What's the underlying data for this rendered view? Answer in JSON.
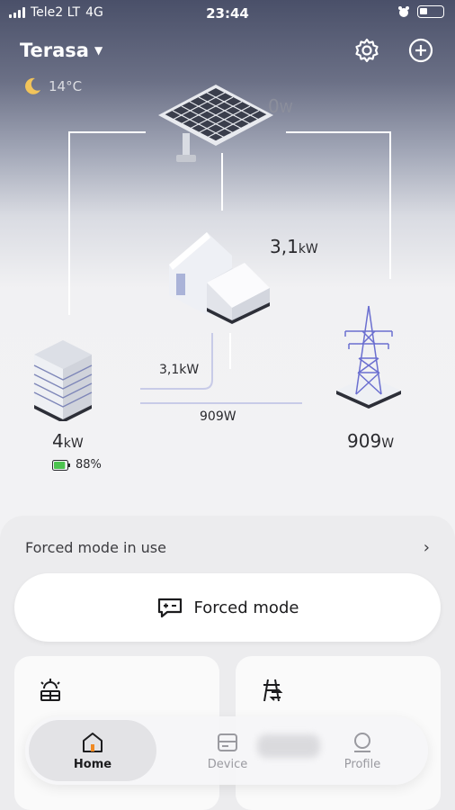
{
  "status_bar": {
    "carrier": "Tele2 LT",
    "network": "4G",
    "time": "23:44"
  },
  "header": {
    "site_name": "Terasa",
    "weather_temp": "14°C"
  },
  "energy_flow": {
    "solar_power": "0",
    "solar_unit": "W",
    "home_power": "3,1",
    "home_unit": "kW",
    "battery_power": "4",
    "battery_unit": "kW",
    "battery_soc": "88%",
    "battery_soc_level": 0.88,
    "grid_power": "909",
    "grid_unit": "W",
    "flow_battery_to_home": "3,1kW",
    "flow_battery_to_grid": "909W"
  },
  "forced": {
    "status_text": "Forced mode in use",
    "button_label": "Forced mode"
  },
  "tabs": [
    {
      "label": "Home"
    },
    {
      "label": "Device"
    },
    {
      "label": "Profile"
    }
  ],
  "colors": {
    "battery_green": "#4cc34f",
    "tower_blue": "#6b6fd0",
    "accent_orange": "#f08a24"
  }
}
